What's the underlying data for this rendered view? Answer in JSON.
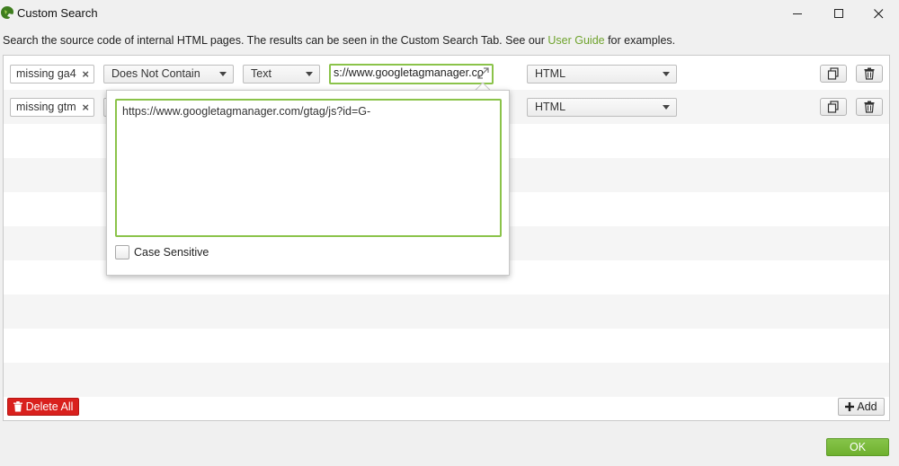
{
  "window": {
    "title": "Custom Search"
  },
  "description": {
    "text_before": "Search the source code of internal HTML pages. The results can be seen in the Custom Search Tab. See our ",
    "link": "User Guide",
    "text_after": " for examples."
  },
  "rows": [
    {
      "name": "missing ga4",
      "condition": "Does Not Contain",
      "type": "Text",
      "value": "s://www.googletagmanager.co",
      "scope": "HTML"
    },
    {
      "name": "missing gtm",
      "scope": "HTML"
    }
  ],
  "popup": {
    "textarea_value": "https://www.googletagmanager.com/gtag/js?id=G-",
    "case_sensitive_label": "Case Sensitive"
  },
  "footer": {
    "delete_all_label": "Delete All",
    "add_label": "Add",
    "ok_label": "OK"
  },
  "colors": {
    "accent_green": "#8bc34a",
    "delete_red": "#d9201d",
    "link_green": "#6fa32d"
  }
}
